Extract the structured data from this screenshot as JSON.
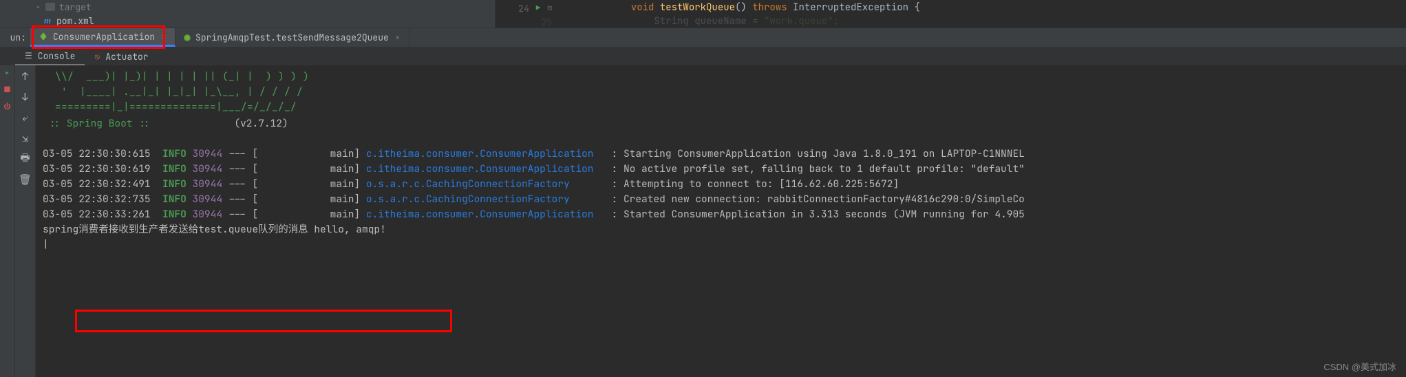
{
  "project": {
    "target_folder": "target",
    "pom_file": "pom.xml"
  },
  "editor": {
    "line24_num": "24",
    "line25_num": "25",
    "code_prefix": "            ",
    "kw_void": "void",
    "method_name": " testWorkQueue",
    "paren": "() ",
    "kw_throws": "throws",
    "exc": " InterruptedException {",
    "line2_indent": "                ",
    "line2_type": "String ",
    "line2_var": "queueName",
    "line2_eq": " = ",
    "line2_val": "\"work.queue\";"
  },
  "run_panel": {
    "label": "un:",
    "tab1": "ConsumerApplication",
    "tab2": "SpringAmqpTest.testSendMessage2Queue"
  },
  "sub_tabs": {
    "console": "Console",
    "actuator": "Actuator"
  },
  "ascii_art": [
    "  \\\\/  ___)| |_)| | | | | || (_| |  ) ) ) )",
    "   '  |____| .__|_| |_|_| |_\\__, | / / / /",
    "  =========|_|==============|___/=/_/_/_/"
  ],
  "spring_boot": {
    "name": " :: Spring Boot :: ",
    "version": "             (v2.7.12)"
  },
  "logs": [
    {
      "ts": "03-05 22:30:30:615",
      "lvl": "INFO",
      "pid": "30944",
      "thread": "main",
      "logger": "c.itheima.consumer.ConsumerApplication  ",
      "msg": "Starting ConsumerApplication using Java 1.8.0_191 on LAPTOP-C1NNNEL"
    },
    {
      "ts": "03-05 22:30:30:619",
      "lvl": "INFO",
      "pid": "30944",
      "thread": "main",
      "logger": "c.itheima.consumer.ConsumerApplication  ",
      "msg": "No active profile set, falling back to 1 default profile: \"default\""
    },
    {
      "ts": "03-05 22:30:32:491",
      "lvl": "INFO",
      "pid": "30944",
      "thread": "main",
      "logger": "o.s.a.r.c.CachingConnectionFactory      ",
      "msg": "Attempting to connect to: [116.62.60.225:5672]"
    },
    {
      "ts": "03-05 22:30:32:735",
      "lvl": "INFO",
      "pid": "30944",
      "thread": "main",
      "logger": "o.s.a.r.c.CachingConnectionFactory      ",
      "msg": "Created new connection: rabbitConnectionFactory#4816c290:0/SimpleCo"
    },
    {
      "ts": "03-05 22:30:33:261",
      "lvl": "INFO",
      "pid": "30944",
      "thread": "main",
      "logger": "c.itheima.consumer.ConsumerApplication  ",
      "msg": "Started ConsumerApplication in 3.313 seconds (JVM running for 4.905"
    }
  ],
  "output": "spring消费者接收到生产者发送给test.queue队列的消息 hello, amqp!",
  "watermark": "CSDN @美式加冰"
}
